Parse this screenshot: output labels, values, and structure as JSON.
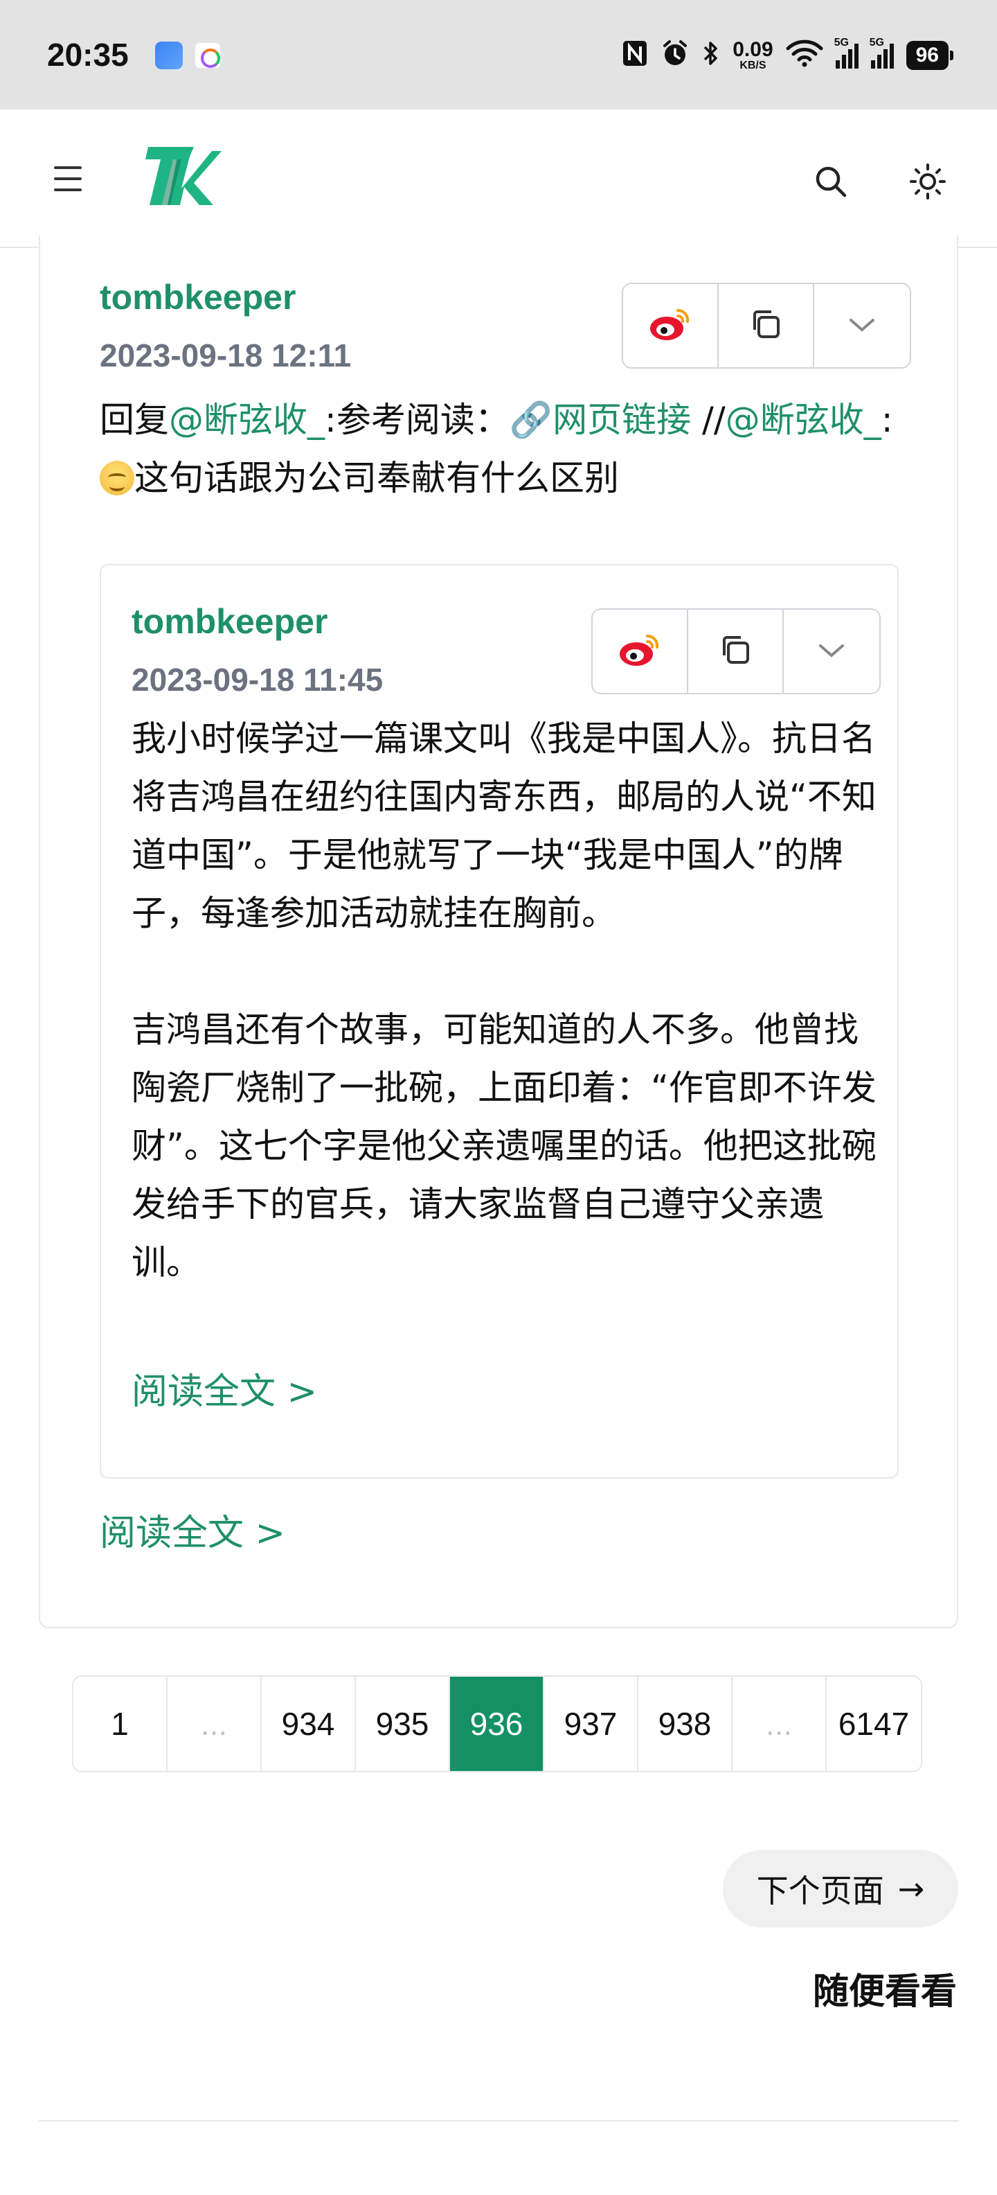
{
  "status_bar": {
    "time": "20:35",
    "net_speed_value": "0.09",
    "net_speed_unit": "KB/S",
    "signal1_label": "5G",
    "signal2_label": "5G",
    "battery": "96"
  },
  "header": {
    "icons": [
      "menu-icon",
      "logo",
      "search-icon",
      "sun-icon"
    ],
    "brand_color": "#1e8f6a"
  },
  "post": {
    "author": "tombkeeper",
    "time": "2023-09-18 12:11",
    "text_prefix": "回复",
    "mention1": "@断弦收_",
    "text_mid": ":参考阅读：",
    "link_text": "🔗网页链接",
    "repost_sep": " //",
    "mention2": "@断弦收_",
    "mention2_suffix": ":",
    "text_suffix": "这句话跟为公司奉献有什么区别",
    "read_more": "阅读全文 >",
    "action_icons": [
      "weibo-icon",
      "copy-icon",
      "chevron-down-icon"
    ]
  },
  "quote": {
    "author": "tombkeeper",
    "time": "2023-09-18 11:45",
    "para1": "我小时候学过一篇课文叫《我是中国人》。抗日名将吉鸿昌在纽约往国内寄东西，邮局的人说“不知道中国”。于是他就写了一块“我是中国人”的牌子，每逢参加活动就挂在胸前。",
    "para2": "吉鸿昌还有个故事，可能知道的人不多。他曾找陶瓷厂烧制了一批碗，上面印着：“作官即不许发财”。这七个字是他父亲遗嘱里的话。他把这批碗发给手下的官兵，请大家监督自己遵守父亲遗训。",
    "read_more": "阅读全文 >"
  },
  "pagination": {
    "pages": [
      "1",
      "...",
      "934",
      "935",
      "936",
      "937",
      "938",
      "...",
      "6147"
    ],
    "current": "936",
    "active_color": "#139164"
  },
  "next_page": {
    "label": "下个页面",
    "arrow": "→"
  },
  "random_link": "随便看看"
}
